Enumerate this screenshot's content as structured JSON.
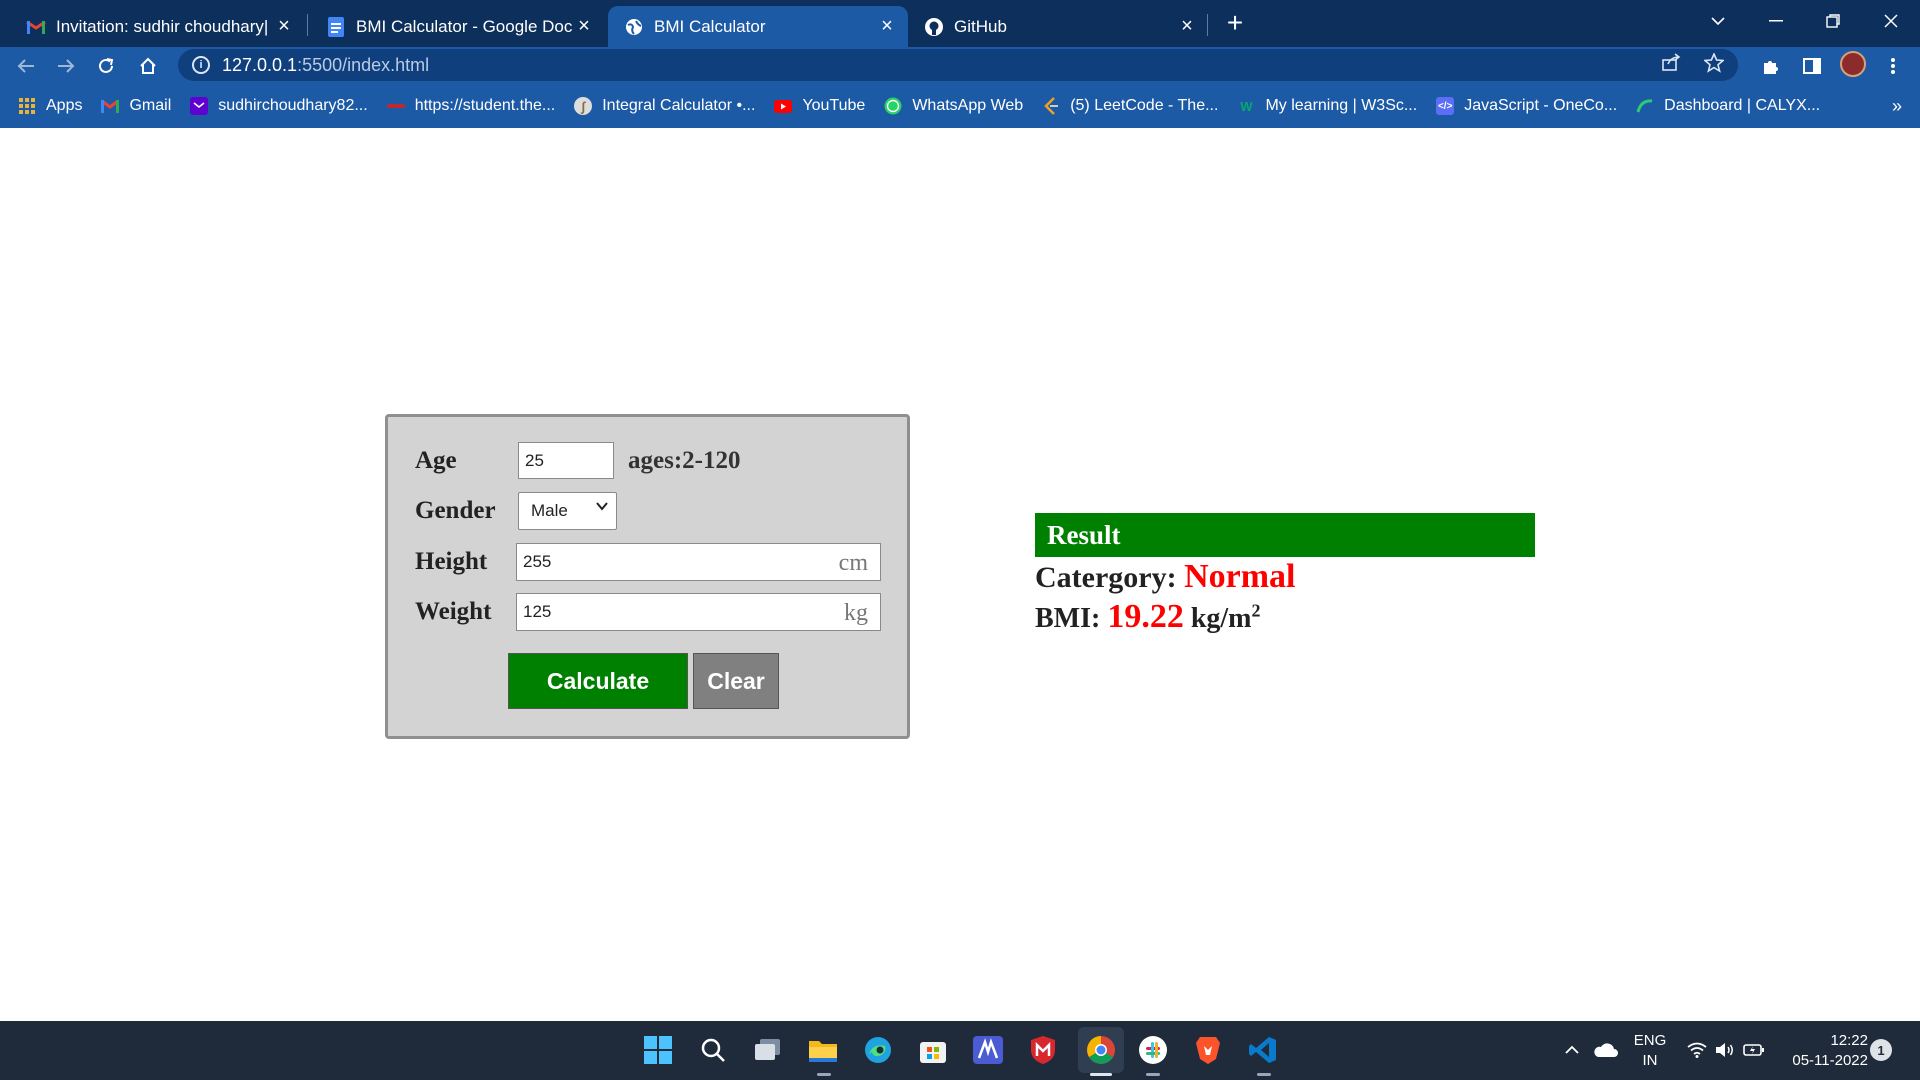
{
  "browser": {
    "tabs": [
      {
        "title": "Invitation: sudhir choudhary| Plac",
        "icon": "gmail-icon",
        "active": false
      },
      {
        "title": "BMI Calculator - Google Docs",
        "icon": "google-docs-icon",
        "active": false
      },
      {
        "title": "BMI Calculator",
        "icon": "globe-icon",
        "active": true
      },
      {
        "title": "GitHub",
        "icon": "github-icon",
        "active": false
      }
    ],
    "url_host": "127.0.0.1",
    "url_path": ":5500/index.html",
    "bookmarks": [
      {
        "label": "Apps",
        "icon": "apps-grid-icon"
      },
      {
        "label": "Gmail",
        "icon": "gmail-icon"
      },
      {
        "label": "sudhirchoudhary82...",
        "icon": "yahoo-mail-icon"
      },
      {
        "label": "https://student.the...",
        "icon": "site-icon"
      },
      {
        "label": "Integral Calculator •...",
        "icon": "calculator-site-icon"
      },
      {
        "label": "YouTube",
        "icon": "youtube-icon"
      },
      {
        "label": "WhatsApp Web",
        "icon": "whatsapp-icon"
      },
      {
        "label": "(5) LeetCode - The...",
        "icon": "leetcode-icon"
      },
      {
        "label": "My learning | W3Sc...",
        "icon": "w3schools-icon"
      },
      {
        "label": "JavaScript - OneCo...",
        "icon": "onecompiler-icon"
      },
      {
        "label": "Dashboard | CALYX...",
        "icon": "calyx-icon"
      }
    ],
    "bookmarks_more": "»"
  },
  "form": {
    "age_label": "Age",
    "age_value": "25",
    "age_hint": "ages:2-120",
    "gender_label": "Gender",
    "gender_value": "Male",
    "height_label": "Height",
    "height_value": "255",
    "height_unit": "cm",
    "weight_label": "Weight",
    "weight_value": "125",
    "weight_unit": "kg",
    "calculate_label": "Calculate",
    "clear_label": "Clear"
  },
  "result": {
    "heading": "Result",
    "category_label": "Catergory:",
    "category_value": "Normal",
    "bmi_label": "BMI:",
    "bmi_value": "19.22",
    "bmi_unit": "kg/m",
    "bmi_unit_exp": "2"
  },
  "taskbar": {
    "lang_top": "ENG",
    "lang_bottom": "IN",
    "time": "12:22",
    "date": "05-11-2022",
    "notification_count": "1"
  },
  "colors": {
    "tab_strip": "#0d2f5c",
    "toolbar": "#1d5aa6",
    "green": "#008000",
    "red": "#ff0000",
    "form_bg": "#d3d3d3"
  }
}
